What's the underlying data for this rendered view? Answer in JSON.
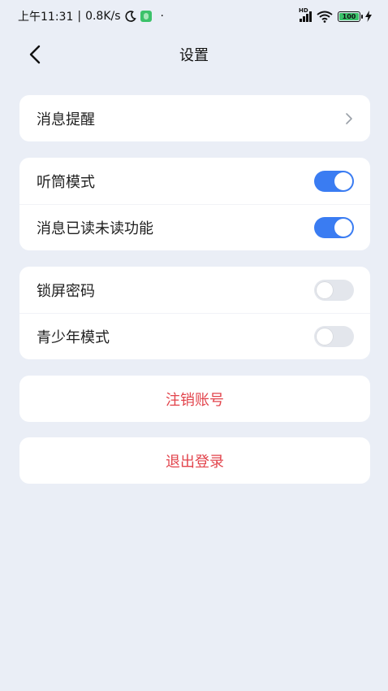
{
  "status_bar": {
    "time": "上午11:31",
    "speed": "0.8K/s",
    "dot": "·",
    "network": "HD",
    "battery": "100",
    "icons": [
      "moon-icon",
      "app-notification-icon",
      "signal-icon",
      "wifi-icon",
      "battery-icon",
      "charging-icon"
    ]
  },
  "header": {
    "title": "设置",
    "back_icon": "back-arrow-icon"
  },
  "sections": {
    "notifications": {
      "label": "消息提醒",
      "icon": "chevron-right-icon"
    },
    "toggles": [
      {
        "label": "听筒模式",
        "on": true
      },
      {
        "label": "消息已读未读功能",
        "on": true
      }
    ],
    "security": [
      {
        "label": "锁屏密码",
        "on": false
      },
      {
        "label": "青少年模式",
        "on": false
      }
    ]
  },
  "actions": {
    "cancel_account": "注销账号",
    "logout": "退出登录"
  },
  "colors": {
    "background": "#eaeef6",
    "toggle_on": "#3a7cf2",
    "toggle_off": "#e3e6ec",
    "danger": "#e2444c"
  }
}
